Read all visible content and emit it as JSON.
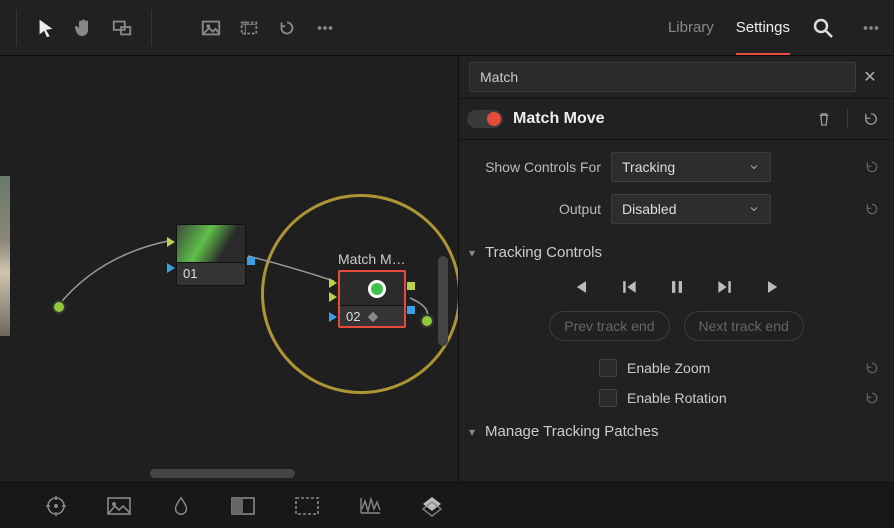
{
  "topbar": {
    "tools": [
      "arrow",
      "hand",
      "rect-select"
    ],
    "tools2": [
      "image",
      "crop",
      "history"
    ]
  },
  "tabs": {
    "library": "Library",
    "settings": "Settings",
    "active": "settings"
  },
  "search": {
    "value": "Match",
    "placeholder": "Search"
  },
  "title": {
    "label": "Match Move",
    "enabled": true
  },
  "props": {
    "show_controls_label": "Show Controls For",
    "show_controls_value": "Tracking",
    "output_label": "Output",
    "output_value": "Disabled"
  },
  "sections": {
    "tracking_controls": "Tracking Controls",
    "manage_patches": "Manage Tracking Patches"
  },
  "track_buttons": {
    "prev": "Prev track end",
    "next": "Next track end"
  },
  "checks": {
    "zoom": "Enable Zoom",
    "rotation": "Enable Rotation"
  },
  "nodes": {
    "n01": {
      "label": "01"
    },
    "n02": {
      "title": "Match M…",
      "label": "02"
    }
  }
}
